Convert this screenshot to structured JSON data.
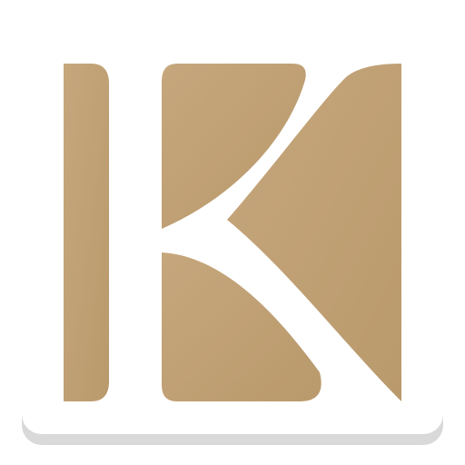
{
  "app_icon": {
    "icon": "k-monogram-icon",
    "colors": {
      "tile": "#ffffff",
      "tile_shadow": "#d9d9d9",
      "tan_light": "#c6a67c",
      "tan_dark": "#b99a6c"
    }
  }
}
